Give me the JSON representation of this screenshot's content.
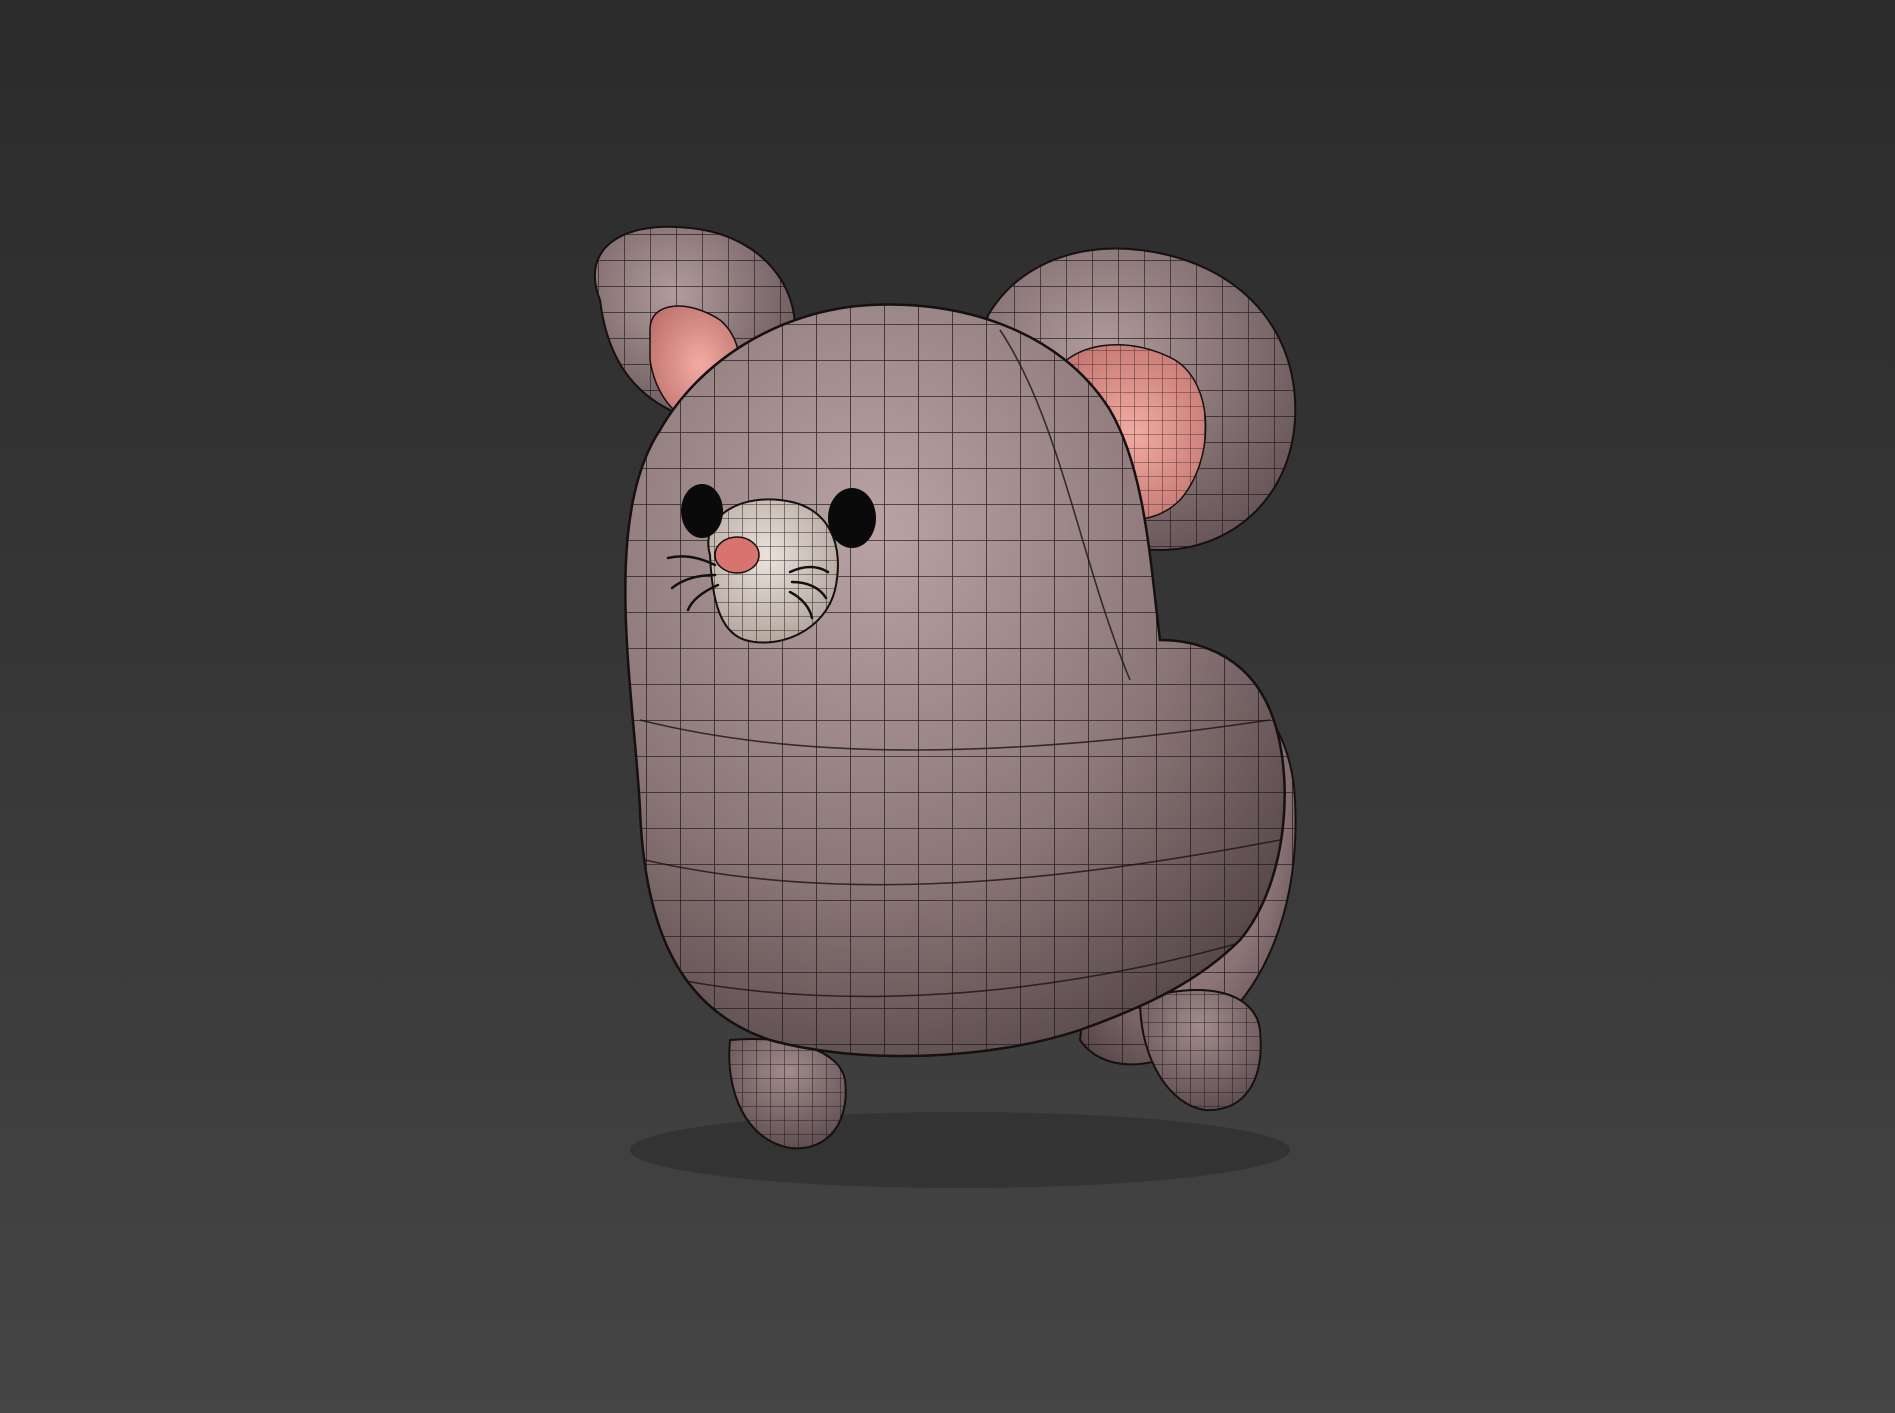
{
  "viewport": {
    "background_top": "#2b2b2b",
    "background_bottom": "#454545"
  },
  "model": {
    "subject": "mouse-character-wireframe",
    "body_color": "#8a7677",
    "inner_ear_color": "#e39a92",
    "muzzle_color": "#d9cfc9",
    "nose_color": "#d8746f",
    "eye_color": "#0a0a0a",
    "wire_color": "#1a1414"
  }
}
